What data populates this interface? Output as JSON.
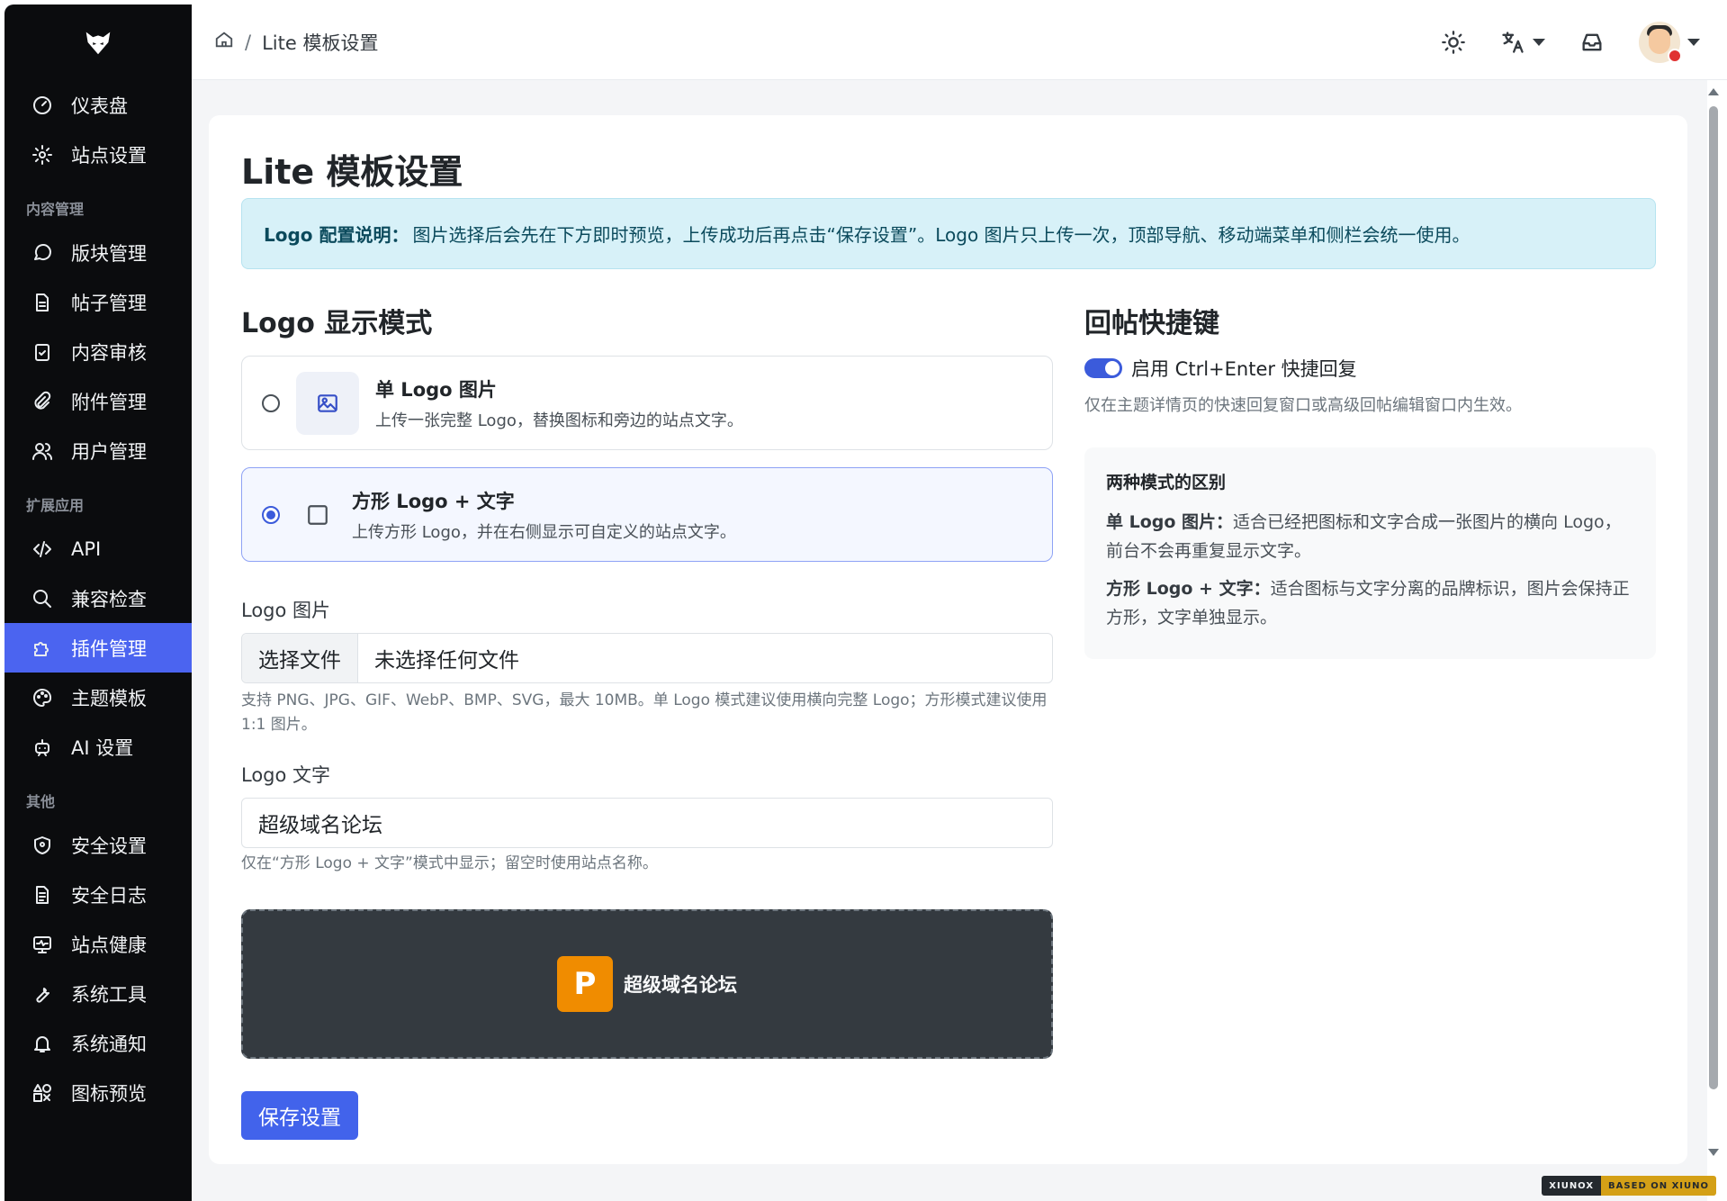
{
  "sidebar": {
    "items": [
      {
        "label": "仪表盘",
        "icon": "dashboard-icon"
      },
      {
        "label": "站点设置",
        "icon": "gear-icon"
      }
    ],
    "section_content": "内容管理",
    "content_items": [
      {
        "label": "版块管理",
        "icon": "chat-icon"
      },
      {
        "label": "帖子管理",
        "icon": "document-icon"
      },
      {
        "label": "内容审核",
        "icon": "clipboard-check-icon"
      },
      {
        "label": "附件管理",
        "icon": "paperclip-icon"
      },
      {
        "label": "用户管理",
        "icon": "users-icon"
      }
    ],
    "section_ext": "扩展应用",
    "ext_items": [
      {
        "label": "API",
        "icon": "code-icon"
      },
      {
        "label": "兼容检查",
        "icon": "search-icon"
      },
      {
        "label": "插件管理",
        "icon": "puzzle-icon",
        "active": true
      },
      {
        "label": "主题模板",
        "icon": "palette-icon"
      },
      {
        "label": "AI 设置",
        "icon": "robot-icon"
      }
    ],
    "section_other": "其他",
    "other_items": [
      {
        "label": "安全设置",
        "icon": "shield-icon"
      },
      {
        "label": "安全日志",
        "icon": "log-icon"
      },
      {
        "label": "站点健康",
        "icon": "monitor-pulse-icon"
      },
      {
        "label": "系统工具",
        "icon": "wrench-icon"
      },
      {
        "label": "系统通知",
        "icon": "bell-icon"
      },
      {
        "label": "图标预览",
        "icon": "shapes-icon"
      }
    ]
  },
  "topbar": {
    "breadcrumb_sep": "/",
    "breadcrumb_current": "Lite 模板设置"
  },
  "page": {
    "title": "Lite 模板设置",
    "alert_strong": "Logo 配置说明：",
    "alert_text": "图片选择后会先在下方即时预览，上传成功后再点击“保存设置”。Logo 图片只上传一次，顶部导航、移动端菜单和侧栏会统一使用。"
  },
  "logo_mode": {
    "title": "Logo 显示模式",
    "option1_title": "单 Logo 图片",
    "option1_desc": "上传一张完整 Logo，替换图标和旁边的站点文字。",
    "option2_title": "方形 Logo + 文字",
    "option2_desc": "上传方形 Logo，并在右侧显示可自定义的站点文字。",
    "selected": 2
  },
  "logo_image": {
    "label": "Logo 图片",
    "button": "选择文件",
    "file_name": "未选择任何文件",
    "help": "支持 PNG、JPG、GIF、WebP、BMP、SVG，最大 10MB。单 Logo 模式建议使用横向完整 Logo；方形模式建议使用 1:1 图片。"
  },
  "logo_text": {
    "label": "Logo 文字",
    "value": "超级域名论坛",
    "help": "仅在“方形 Logo + 文字”模式中显示；留空时使用站点名称。"
  },
  "preview": {
    "letter": "P",
    "text": "超级域名论坛"
  },
  "save_label": "保存设置",
  "shortcut": {
    "title": "回帖快捷键",
    "toggle_label": "启用 Ctrl+Enter 快捷回复",
    "toggle_on": true,
    "help": "仅在主题详情页的快速回复窗口或高级回帖编辑窗口内生效。"
  },
  "diff": {
    "title": "两种模式的区别",
    "p1_strong": "单 Logo 图片：",
    "p1_text": "适合已经把图标和文字合成一张图片的横向 Logo，前台不会再重复显示文字。",
    "p2_strong": "方形 Logo + 文字：",
    "p2_text": "适合图标与文字分离的品牌标识，图片会保持正方形，文字单独显示。"
  },
  "footer": {
    "left": "XIUNOX",
    "right": "BASED ON XIUNO"
  },
  "colors": {
    "accent": "#4263eb",
    "sidebar_bg": "#0b0c0e",
    "preview_logo": "#f08c00"
  }
}
